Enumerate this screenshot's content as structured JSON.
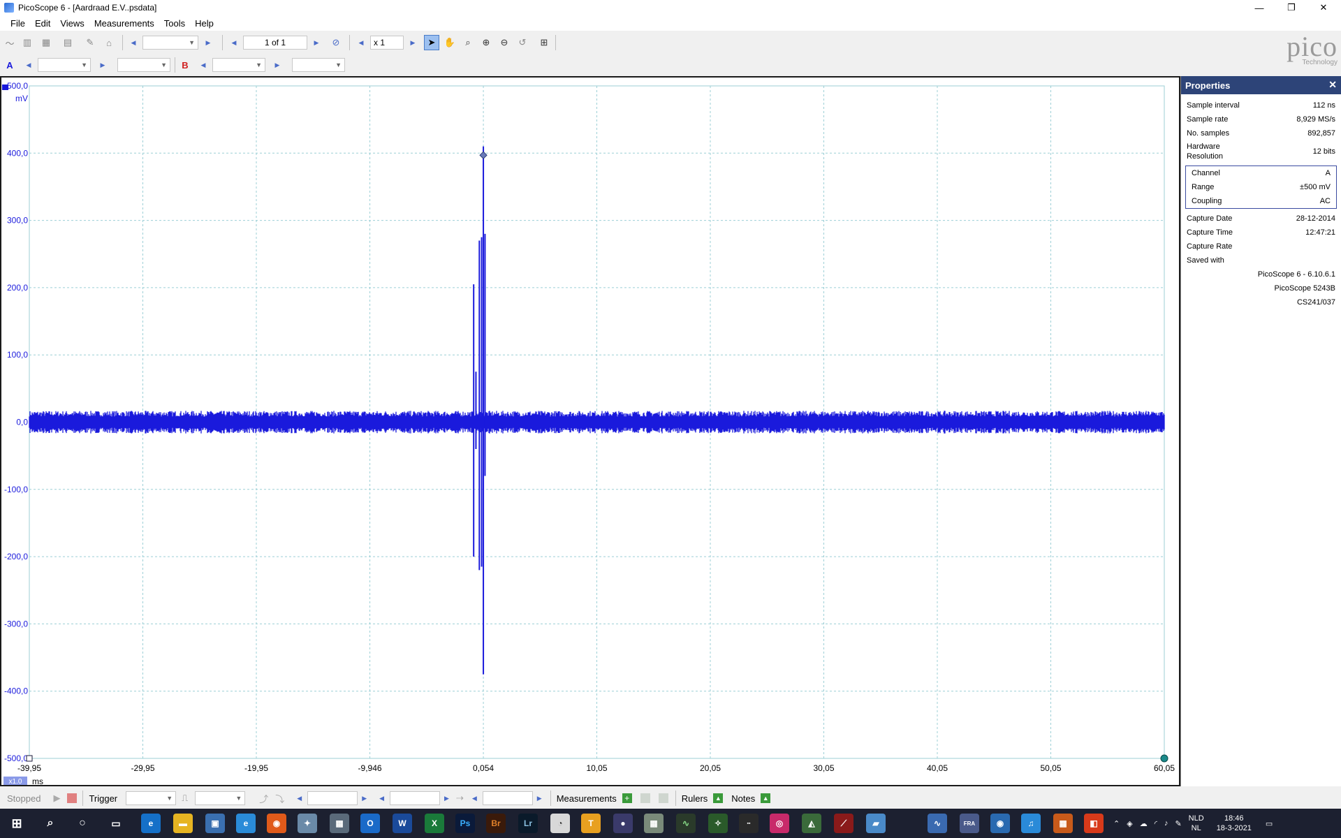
{
  "window": {
    "title": "PicoScope 6 - [Aardraad E.V..psdata]",
    "min": "—",
    "max": "❐",
    "close": "✕"
  },
  "menu": {
    "items": [
      {
        "label": "File"
      },
      {
        "label": "Edit"
      },
      {
        "label": "Views"
      },
      {
        "label": "Measurements"
      },
      {
        "label": "Tools"
      },
      {
        "label": "Help"
      }
    ]
  },
  "toolbar": {
    "page_indicator": "1 of 1",
    "zoom_factor": "x 1"
  },
  "channels": {
    "a_label": "A",
    "b_label": "B"
  },
  "logo": {
    "text": "pico",
    "sub": "Technology"
  },
  "chart_data": {
    "type": "line",
    "ylabel": "mV",
    "xlabel": "ms",
    "x_unit_badge": "x1.0",
    "ylim": [
      -500,
      500
    ],
    "xlim": [
      -39.95,
      60.05
    ],
    "y_ticks": [
      "500,0",
      "400,0",
      "300,0",
      "200,0",
      "100,0",
      "0,0",
      "-100,0",
      "-200,0",
      "-300,0",
      "-400,0",
      "-500,0"
    ],
    "y_tick_values": [
      500,
      400,
      300,
      200,
      100,
      0,
      -100,
      -200,
      -300,
      -400,
      -500
    ],
    "x_ticks": [
      "-39,95",
      "-29,95",
      "-19,95",
      "-9,946",
      "0,054",
      "10,05",
      "20,05",
      "30,05",
      "40,05",
      "50,05",
      "60,05"
    ],
    "x_tick_values": [
      -39.95,
      -29.95,
      -19.95,
      -9.946,
      0.054,
      10.05,
      20.05,
      30.05,
      40.05,
      50.05,
      60.05
    ],
    "grid": true,
    "series": [
      {
        "color": "#1a1adc",
        "noise_band_mV": 14,
        "spikes": [
          {
            "x": -0.8,
            "min": -200,
            "max": 205
          },
          {
            "x": -0.6,
            "min": -40,
            "max": 75
          },
          {
            "x": -0.3,
            "min": -220,
            "max": 270
          },
          {
            "x": -0.1,
            "min": -215,
            "max": 275
          },
          {
            "x": 0.054,
            "min": -375,
            "max": 410
          },
          {
            "x": 0.2,
            "min": -80,
            "max": 280
          }
        ]
      }
    ],
    "trigger_marker": {
      "x": 0.054,
      "y": 397
    }
  },
  "properties": {
    "title": "Properties",
    "rows": [
      {
        "label": "Sample interval",
        "value": "112 ns"
      },
      {
        "label": "Sample rate",
        "value": "8,929 MS/s"
      },
      {
        "label": "No. samples",
        "value": "892,857"
      },
      {
        "label": "Hardware Resolution",
        "value": "12 bits"
      }
    ],
    "channel_group": [
      {
        "label": "Channel",
        "value": "A"
      },
      {
        "label": "Range",
        "value": "±500 mV"
      },
      {
        "label": "Coupling",
        "value": "AC"
      }
    ],
    "capture_rows": [
      {
        "label": "Capture Date",
        "value": "28-12-2014"
      },
      {
        "label": "Capture Time",
        "value": "12:47:21"
      },
      {
        "label": "Capture Rate",
        "value": ""
      },
      {
        "label": "Saved with",
        "value": ""
      }
    ],
    "saved_with": [
      "PicoScope 6 - 6.10.6.1",
      "PicoScope 5243B",
      "CS241/037"
    ]
  },
  "status": {
    "state": "Stopped",
    "trigger": "Trigger",
    "measurements": "Measurements",
    "rulers": "Rulers",
    "notes": "Notes"
  },
  "taskbar": {
    "lang1": "NLD",
    "lang2": "NL",
    "time": "18:46",
    "date": "18-3-2021"
  }
}
